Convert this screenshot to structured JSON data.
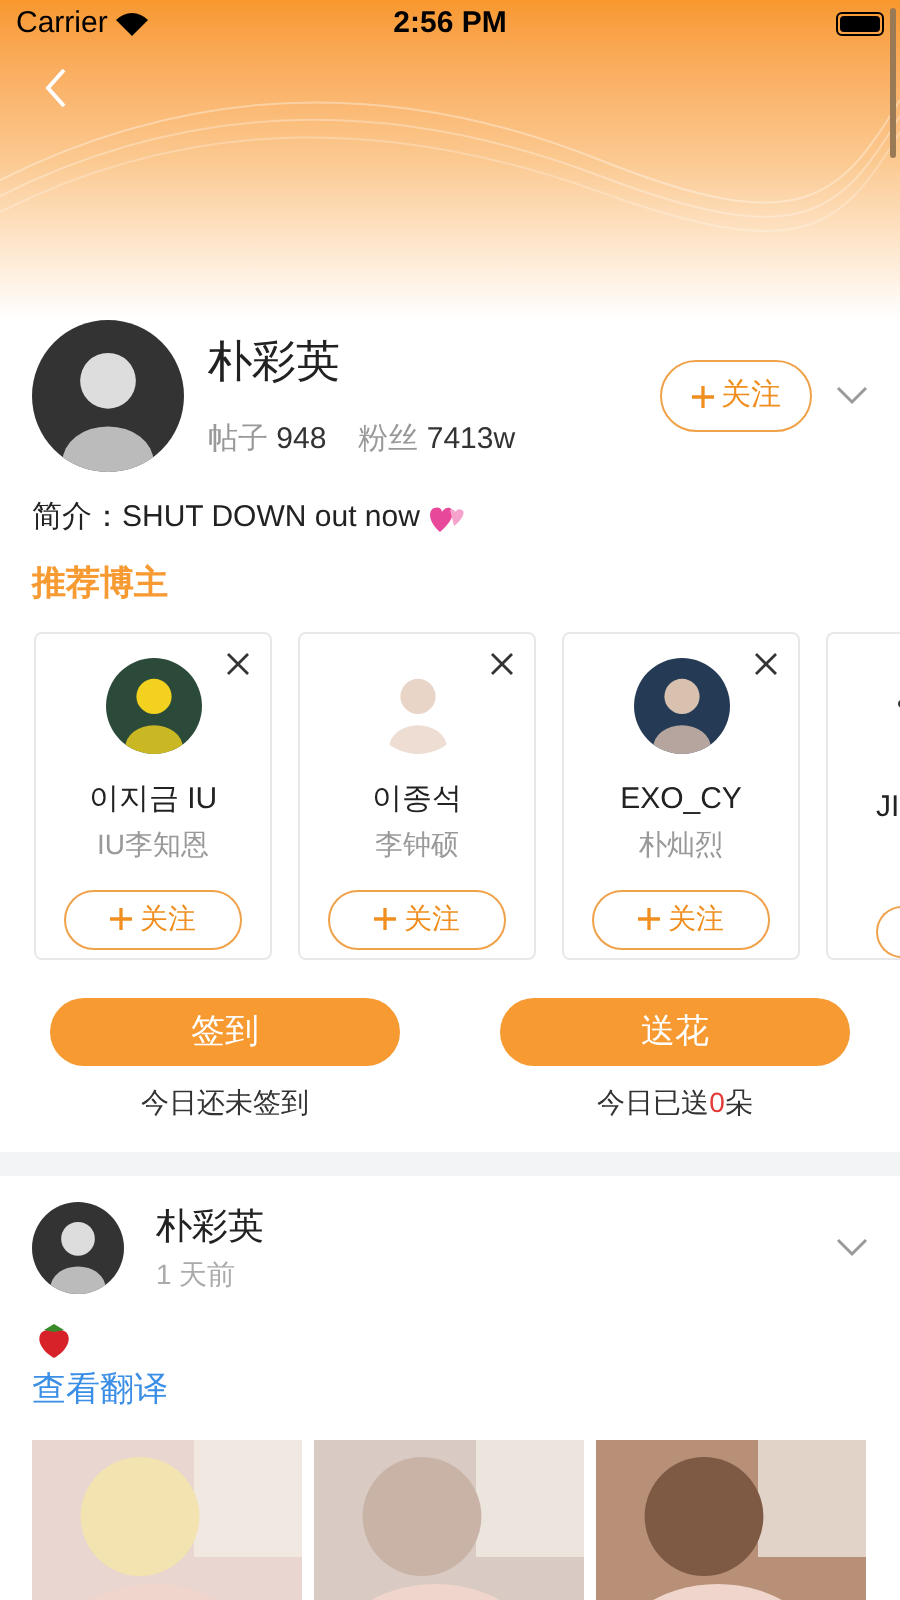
{
  "status_bar": {
    "carrier": "Carrier",
    "time": "2:56 PM"
  },
  "profile": {
    "name": "朴彩英",
    "posts_label": "帖子",
    "posts": "948",
    "fans_label": "粉丝",
    "fans": "7413w",
    "follow": "关注",
    "bio": "简介：SHUT DOWN out now"
  },
  "recommended": {
    "title": "推荐博主",
    "cards": [
      {
        "name": "이지금 IU",
        "sub": "IU李知恩",
        "follow": "关注",
        "kind": "full"
      },
      {
        "name": "이종석",
        "sub": "李钟硕",
        "follow": "关注",
        "kind": "full"
      },
      {
        "name": "EXO_CY",
        "sub": "朴灿烈",
        "follow": "关注",
        "kind": "full"
      },
      {
        "name": "JI",
        "kind": "partial"
      }
    ]
  },
  "actions": [
    {
      "label": "签到",
      "caption": "今日还未签到"
    },
    {
      "label": "送花",
      "caption_before": "今日已送",
      "count": "0",
      "caption_after": "朵"
    }
  ],
  "post": {
    "author": "朴彩英",
    "time": "1 天前",
    "translate": "查看翻译"
  }
}
